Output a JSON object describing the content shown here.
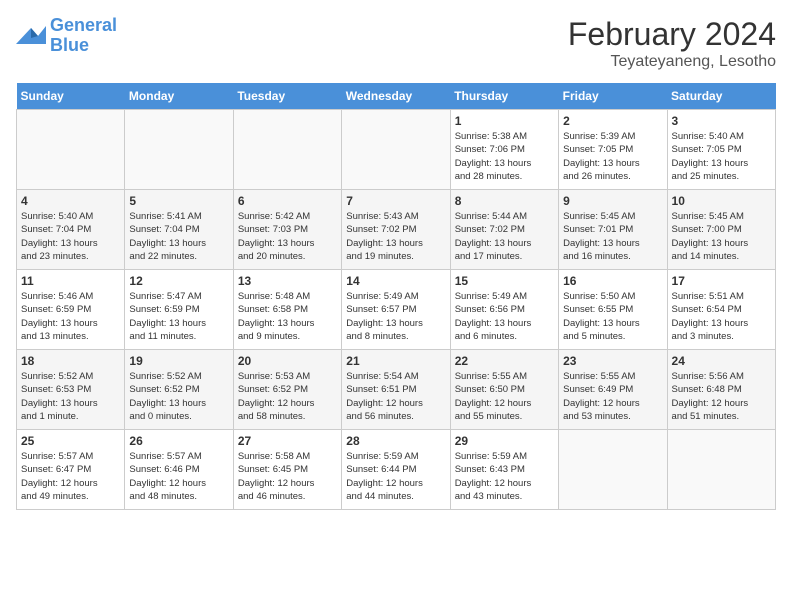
{
  "logo": {
    "text_general": "General",
    "text_blue": "Blue"
  },
  "title": "February 2024",
  "location": "Teyateyaneng, Lesotho",
  "days_of_week": [
    "Sunday",
    "Monday",
    "Tuesday",
    "Wednesday",
    "Thursday",
    "Friday",
    "Saturday"
  ],
  "weeks": [
    [
      {
        "day": "",
        "info": ""
      },
      {
        "day": "",
        "info": ""
      },
      {
        "day": "",
        "info": ""
      },
      {
        "day": "",
        "info": ""
      },
      {
        "day": "1",
        "info": "Sunrise: 5:38 AM\nSunset: 7:06 PM\nDaylight: 13 hours\nand 28 minutes."
      },
      {
        "day": "2",
        "info": "Sunrise: 5:39 AM\nSunset: 7:05 PM\nDaylight: 13 hours\nand 26 minutes."
      },
      {
        "day": "3",
        "info": "Sunrise: 5:40 AM\nSunset: 7:05 PM\nDaylight: 13 hours\nand 25 minutes."
      }
    ],
    [
      {
        "day": "4",
        "info": "Sunrise: 5:40 AM\nSunset: 7:04 PM\nDaylight: 13 hours\nand 23 minutes."
      },
      {
        "day": "5",
        "info": "Sunrise: 5:41 AM\nSunset: 7:04 PM\nDaylight: 13 hours\nand 22 minutes."
      },
      {
        "day": "6",
        "info": "Sunrise: 5:42 AM\nSunset: 7:03 PM\nDaylight: 13 hours\nand 20 minutes."
      },
      {
        "day": "7",
        "info": "Sunrise: 5:43 AM\nSunset: 7:02 PM\nDaylight: 13 hours\nand 19 minutes."
      },
      {
        "day": "8",
        "info": "Sunrise: 5:44 AM\nSunset: 7:02 PM\nDaylight: 13 hours\nand 17 minutes."
      },
      {
        "day": "9",
        "info": "Sunrise: 5:45 AM\nSunset: 7:01 PM\nDaylight: 13 hours\nand 16 minutes."
      },
      {
        "day": "10",
        "info": "Sunrise: 5:45 AM\nSunset: 7:00 PM\nDaylight: 13 hours\nand 14 minutes."
      }
    ],
    [
      {
        "day": "11",
        "info": "Sunrise: 5:46 AM\nSunset: 6:59 PM\nDaylight: 13 hours\nand 13 minutes."
      },
      {
        "day": "12",
        "info": "Sunrise: 5:47 AM\nSunset: 6:59 PM\nDaylight: 13 hours\nand 11 minutes."
      },
      {
        "day": "13",
        "info": "Sunrise: 5:48 AM\nSunset: 6:58 PM\nDaylight: 13 hours\nand 9 minutes."
      },
      {
        "day": "14",
        "info": "Sunrise: 5:49 AM\nSunset: 6:57 PM\nDaylight: 13 hours\nand 8 minutes."
      },
      {
        "day": "15",
        "info": "Sunrise: 5:49 AM\nSunset: 6:56 PM\nDaylight: 13 hours\nand 6 minutes."
      },
      {
        "day": "16",
        "info": "Sunrise: 5:50 AM\nSunset: 6:55 PM\nDaylight: 13 hours\nand 5 minutes."
      },
      {
        "day": "17",
        "info": "Sunrise: 5:51 AM\nSunset: 6:54 PM\nDaylight: 13 hours\nand 3 minutes."
      }
    ],
    [
      {
        "day": "18",
        "info": "Sunrise: 5:52 AM\nSunset: 6:53 PM\nDaylight: 13 hours\nand 1 minute."
      },
      {
        "day": "19",
        "info": "Sunrise: 5:52 AM\nSunset: 6:52 PM\nDaylight: 13 hours\nand 0 minutes."
      },
      {
        "day": "20",
        "info": "Sunrise: 5:53 AM\nSunset: 6:52 PM\nDaylight: 12 hours\nand 58 minutes."
      },
      {
        "day": "21",
        "info": "Sunrise: 5:54 AM\nSunset: 6:51 PM\nDaylight: 12 hours\nand 56 minutes."
      },
      {
        "day": "22",
        "info": "Sunrise: 5:55 AM\nSunset: 6:50 PM\nDaylight: 12 hours\nand 55 minutes."
      },
      {
        "day": "23",
        "info": "Sunrise: 5:55 AM\nSunset: 6:49 PM\nDaylight: 12 hours\nand 53 minutes."
      },
      {
        "day": "24",
        "info": "Sunrise: 5:56 AM\nSunset: 6:48 PM\nDaylight: 12 hours\nand 51 minutes."
      }
    ],
    [
      {
        "day": "25",
        "info": "Sunrise: 5:57 AM\nSunset: 6:47 PM\nDaylight: 12 hours\nand 49 minutes."
      },
      {
        "day": "26",
        "info": "Sunrise: 5:57 AM\nSunset: 6:46 PM\nDaylight: 12 hours\nand 48 minutes."
      },
      {
        "day": "27",
        "info": "Sunrise: 5:58 AM\nSunset: 6:45 PM\nDaylight: 12 hours\nand 46 minutes."
      },
      {
        "day": "28",
        "info": "Sunrise: 5:59 AM\nSunset: 6:44 PM\nDaylight: 12 hours\nand 44 minutes."
      },
      {
        "day": "29",
        "info": "Sunrise: 5:59 AM\nSunset: 6:43 PM\nDaylight: 12 hours\nand 43 minutes."
      },
      {
        "day": "",
        "info": ""
      },
      {
        "day": "",
        "info": ""
      }
    ]
  ]
}
